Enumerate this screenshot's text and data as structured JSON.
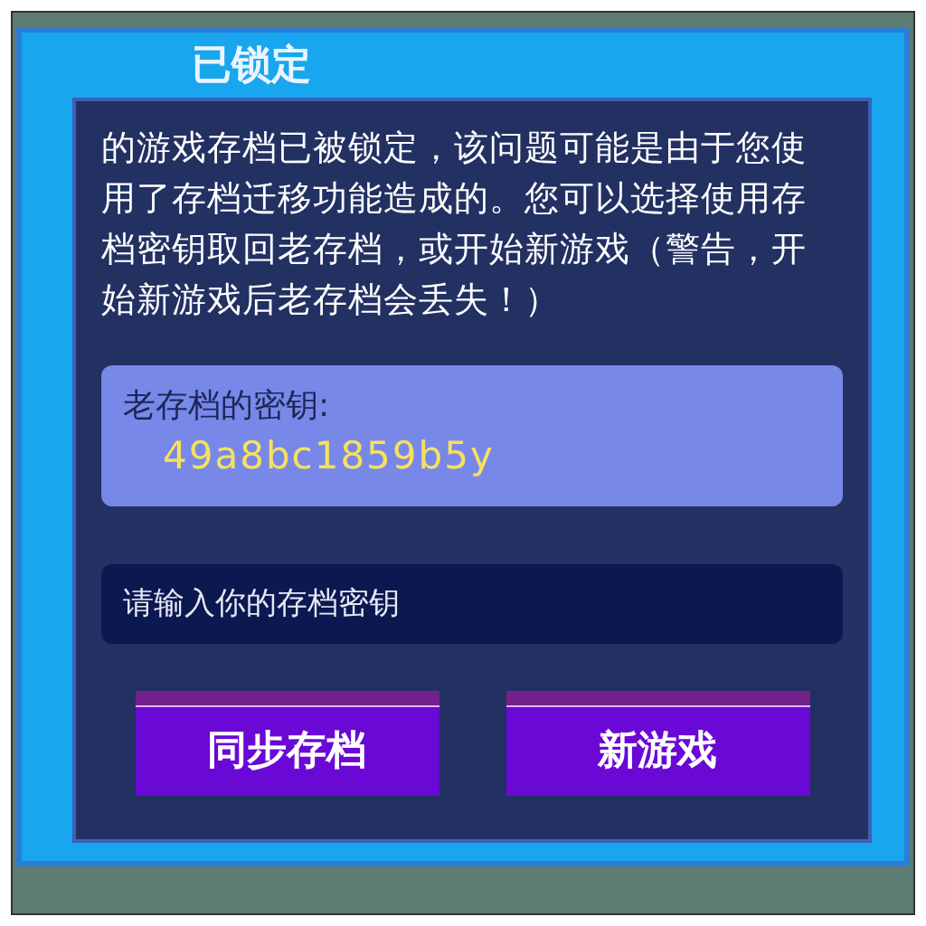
{
  "dialog": {
    "title": "已锁定",
    "message": "的游戏存档已被锁定，该问题可能是由于您使用了存档迁移功能造成的。您可以选择使用存档密钥取回老存档，或开始新游戏（警告，开始新游戏后老存档会丢失！）"
  },
  "key_box": {
    "label": "老存档的密钥:",
    "value": "49a8bc1859b5y"
  },
  "key_input": {
    "placeholder": "请输入你的存档密钥"
  },
  "buttons": [
    "同步存档",
    "新游戏"
  ]
}
